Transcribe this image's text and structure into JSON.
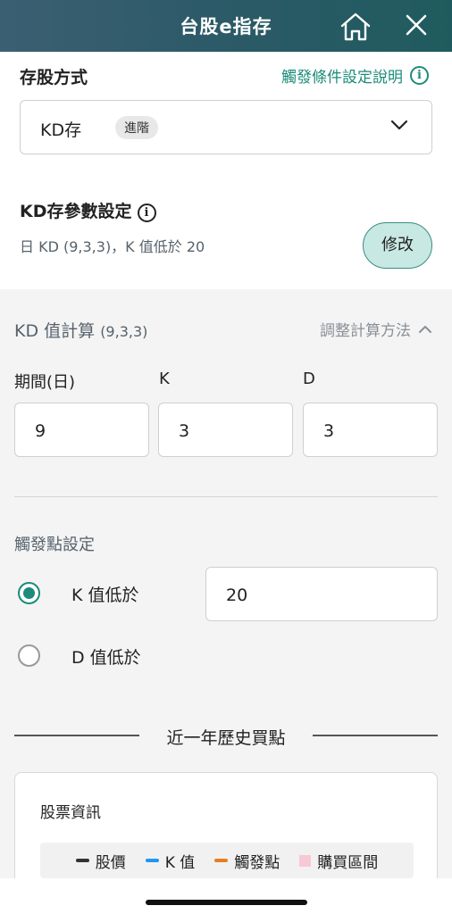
{
  "header": {
    "title": "台股e指存",
    "home_icon": "home-icon",
    "close_icon": "close-icon"
  },
  "deposit": {
    "title": "存股方式",
    "help_link": "觸發條件設定說明",
    "select_value": "KD存",
    "select_badge": "進階"
  },
  "params": {
    "title": "KD存參數設定",
    "summary": "日 KD (9,3,3)，K 值低於 20",
    "edit_button": "修改"
  },
  "calc": {
    "title": "KD 值計算",
    "title_params": "(9,3,3)",
    "adjust_link": "調整計算方法",
    "fields": [
      {
        "label": "期間(日)",
        "value": "9"
      },
      {
        "label": "K",
        "value": "3"
      },
      {
        "label": "D",
        "value": "3"
      }
    ]
  },
  "trigger": {
    "title": "觸發點設定",
    "options": [
      {
        "label": "K 值低於",
        "selected": true
      },
      {
        "label": "D 值低於",
        "selected": false
      }
    ],
    "threshold": "20"
  },
  "history": {
    "title": "近一年歷史買點",
    "card_title": "股票資訊",
    "legend": [
      {
        "label": "股價",
        "color": "#333333",
        "shape": "line"
      },
      {
        "label": "K 值",
        "color": "#2196f3",
        "shape": "line"
      },
      {
        "label": "觸發點",
        "color": "#e67e22",
        "shape": "line"
      },
      {
        "label": "購買區間",
        "color": "#f8c8d4",
        "shape": "box"
      }
    ]
  },
  "colors": {
    "accent": "#1d8a7c",
    "header_start": "#3b5f72",
    "header_end": "#1f5b5e"
  }
}
